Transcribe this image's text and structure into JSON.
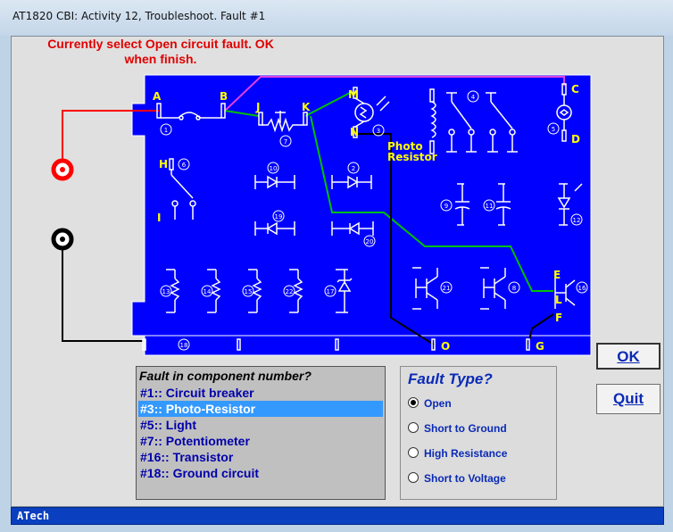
{
  "window": {
    "title": "AT1820 CBI: Activity 12, Troubleshoot. Fault #1"
  },
  "instruction": {
    "line1": "Currently select Open circuit fault. OK",
    "line2": "when finish."
  },
  "board": {
    "points": {
      "A": "A",
      "B": "B",
      "C": "C",
      "D": "D",
      "E": "E",
      "F": "F",
      "G": "G",
      "H": "H",
      "I": "I",
      "J": "J",
      "K": "K",
      "L": "L",
      "M": "M",
      "N": "N",
      "O": "O"
    },
    "component_numbers": [
      "1",
      "2",
      "3",
      "4",
      "5",
      "6",
      "7",
      "8",
      "9",
      "10",
      "11",
      "12",
      "13",
      "14",
      "15",
      "16",
      "17",
      "18",
      "19",
      "20",
      "21",
      "22"
    ],
    "photo_label1": "Photo",
    "photo_label2": "Resistor",
    "colors": {
      "board": "#0000ff",
      "red_wire": "#ff0000",
      "black_wire": "#000000",
      "green_wire": "#00c000",
      "magenta_wire": "#e040e0",
      "label_yellow": "#ffff00"
    }
  },
  "fault_list": {
    "header": "Fault in component number?",
    "items": [
      {
        "label": "#1:: Circuit breaker",
        "selected": false
      },
      {
        "label": "#3:: Photo-Resistor",
        "selected": true
      },
      {
        "label": "#5:: Light",
        "selected": false
      },
      {
        "label": "#7:: Potentiometer",
        "selected": false
      },
      {
        "label": "#16:: Transistor",
        "selected": false
      },
      {
        "label": "#18:: Ground circuit",
        "selected": false
      }
    ]
  },
  "fault_type": {
    "header": "Fault Type?",
    "options": [
      {
        "label": "Open",
        "checked": true
      },
      {
        "label": "Short to Ground",
        "checked": false
      },
      {
        "label": "High Resistance",
        "checked": false
      },
      {
        "label": "Short to Voltage",
        "checked": false
      }
    ]
  },
  "buttons": {
    "ok": "OK",
    "quit": "Quit"
  },
  "status": {
    "text": "ATech"
  }
}
